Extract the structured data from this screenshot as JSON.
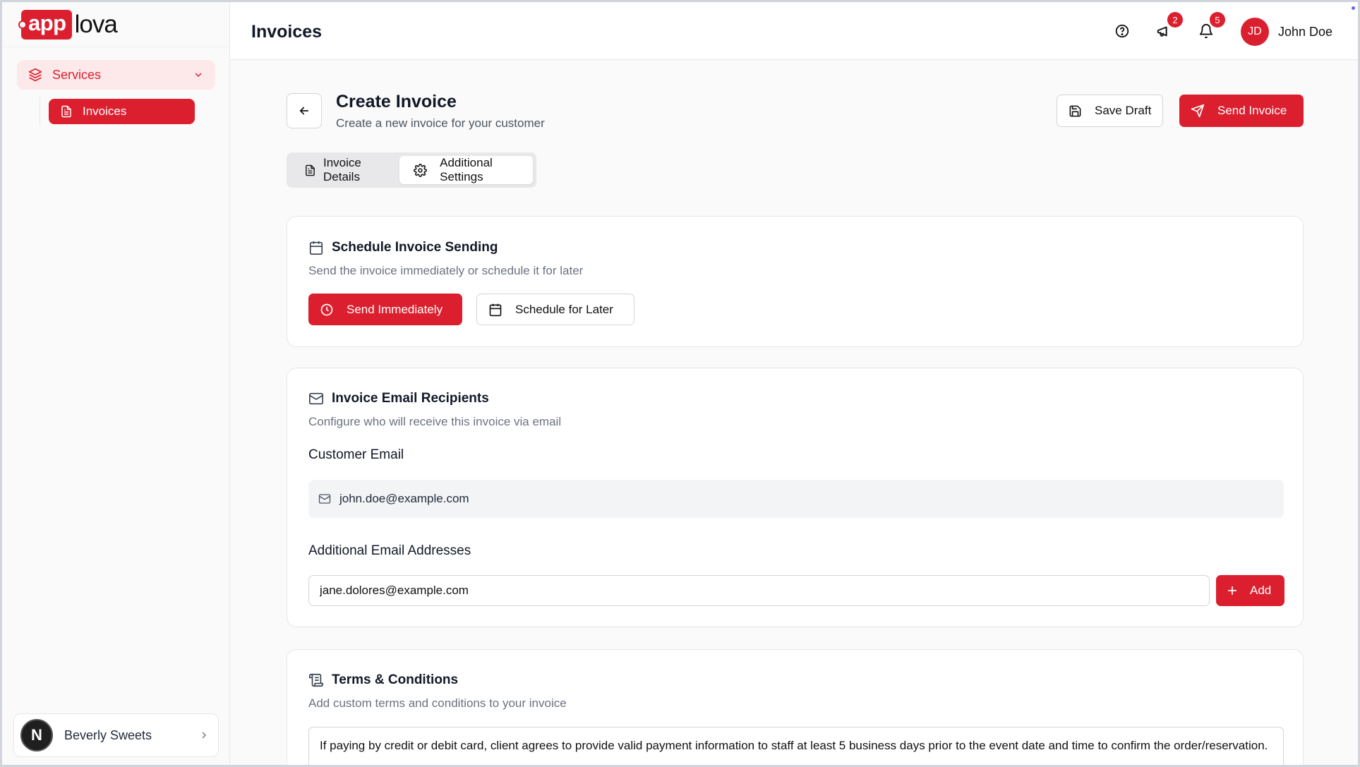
{
  "brand": {
    "logo_box": "app",
    "logo_text": "lova"
  },
  "sidebar": {
    "services_label": "Services",
    "invoices_label": "Invoices",
    "org": {
      "avatar_letter": "N",
      "name": "Beverly Sweets"
    }
  },
  "topbar": {
    "title": "Invoices",
    "announcements_count": "2",
    "notifications_count": "5",
    "user": {
      "initials": "JD",
      "name": "John Doe"
    }
  },
  "header": {
    "title": "Create Invoice",
    "subtitle": "Create a new invoice for your customer",
    "save_draft_label": "Save Draft",
    "send_invoice_label": "Send Invoice"
  },
  "tabs": [
    {
      "label": "Invoice Details",
      "active": false
    },
    {
      "label": "Additional Settings",
      "active": true
    }
  ],
  "schedule": {
    "title": "Schedule Invoice Sending",
    "subtitle": "Send the invoice immediately or schedule it for later",
    "send_immediately_label": "Send Immediately",
    "schedule_later_label": "Schedule for Later"
  },
  "recipients": {
    "title": "Invoice Email Recipients",
    "subtitle": "Configure who will receive this invoice via email",
    "customer_email_label": "Customer Email",
    "customer_email": "john.doe@example.com",
    "additional_label": "Additional Email Addresses",
    "additional_value": "jane.dolores@example.com",
    "add_label": "Add"
  },
  "terms": {
    "title": "Terms & Conditions",
    "subtitle": "Add custom terms and conditions to your invoice",
    "text": "If paying by credit or debit card, client agrees to provide valid payment information to staff at least 5 business days prior to the event date and time to confirm the order/reservation."
  },
  "colors": {
    "accent": "#dc1f2e",
    "accent_light": "#fde8ea"
  }
}
